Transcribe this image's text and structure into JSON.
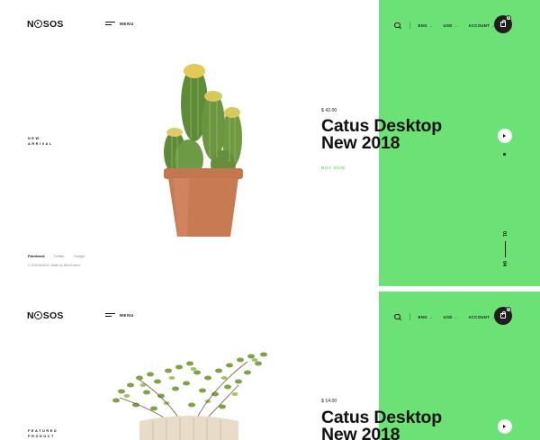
{
  "brand": {
    "logo_left": "N",
    "logo_right": "SOS"
  },
  "colors": {
    "accent": "#6ce276",
    "dark": "#1f1f1f"
  },
  "header": {
    "menu_label": "MENU",
    "currency": "ENG",
    "language": "USD",
    "account": "ACCOUNT",
    "cart_count": "0"
  },
  "slide_1": {
    "side_label_1": "NEW",
    "side_label_2": "ARRIVAL",
    "price": "$ 42.00",
    "title_line_1": "Catus Desktop",
    "title_line_2": "New 2018",
    "buy_label": "BUY NOW",
    "counter_current": "01",
    "counter_total": "04",
    "socials": [
      "Facebook",
      "Twitter",
      "Google"
    ],
    "copyright": "© 2018 NASOS. Made by MixinTheme"
  },
  "slide_2": {
    "side_label_1": "FEATURED",
    "side_label_2": "PRODUCT",
    "price": "$ 14.00",
    "title_line_1": "Catus Desktop",
    "title_line_2": "New 2018"
  }
}
